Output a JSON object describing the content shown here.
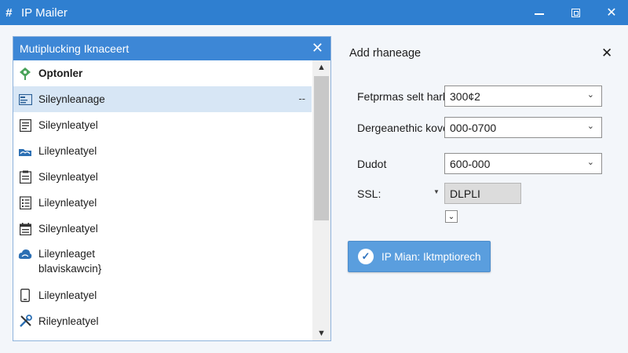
{
  "window": {
    "app_icon": "#",
    "title": "IP Mailer",
    "minimize_icon": "minimize-icon",
    "maximize_icon": "maximize-icon",
    "close_glyph": "✕"
  },
  "left_panel": {
    "title": "Mutiplucking Iknaceert",
    "close_glyph": "✕",
    "items": [
      {
        "label": "Optonler",
        "icon": "diamond-pin-icon",
        "bold": true
      },
      {
        "label": "Sileynleanage",
        "icon": "card-icon",
        "selected": true,
        "trailing": "--"
      },
      {
        "label": "Sileynleatyel",
        "icon": "list-doc-icon"
      },
      {
        "label": "Lileynleatyel",
        "icon": "cloud-folder-icon"
      },
      {
        "label": "Sileynleatyel",
        "icon": "clipboard-icon"
      },
      {
        "label": "Lileynleatyel",
        "icon": "checklist-icon"
      },
      {
        "label": "Sileynleatyel",
        "icon": "calendar-icon"
      },
      {
        "label": "Lileynleaget",
        "sublabel": "blaviskawcin}",
        "icon": "cloud-icon"
      },
      {
        "label": "Lileynleatyel",
        "icon": "phone-icon"
      },
      {
        "label": "Rileynleatyel",
        "icon": "tools-icon"
      }
    ],
    "scroll_up": "▲",
    "scroll_down": "▼"
  },
  "right_panel": {
    "title": "Add rhaneage",
    "close_glyph": "✕",
    "fields": [
      {
        "label": "Fetprmas selt hark.",
        "value": "300¢2"
      },
      {
        "label": "Dergeanethic kove",
        "value": "000-0700"
      },
      {
        "label": "Dudot",
        "value": "600-000"
      }
    ],
    "ssl": {
      "label": "SSL:",
      "arrow": "▼",
      "value": "DLPLI",
      "checked": false,
      "check_glyph": "⌄"
    },
    "primary_button": {
      "label": "IP Mian: Iktmptiorech",
      "icon": "check-circle-icon",
      "check_glyph": "✓"
    },
    "chevron": "⌄",
    "colors": {
      "accent": "#2f7fd0",
      "button": "#5a9ede",
      "selected_row": "#d7e6f5"
    }
  }
}
